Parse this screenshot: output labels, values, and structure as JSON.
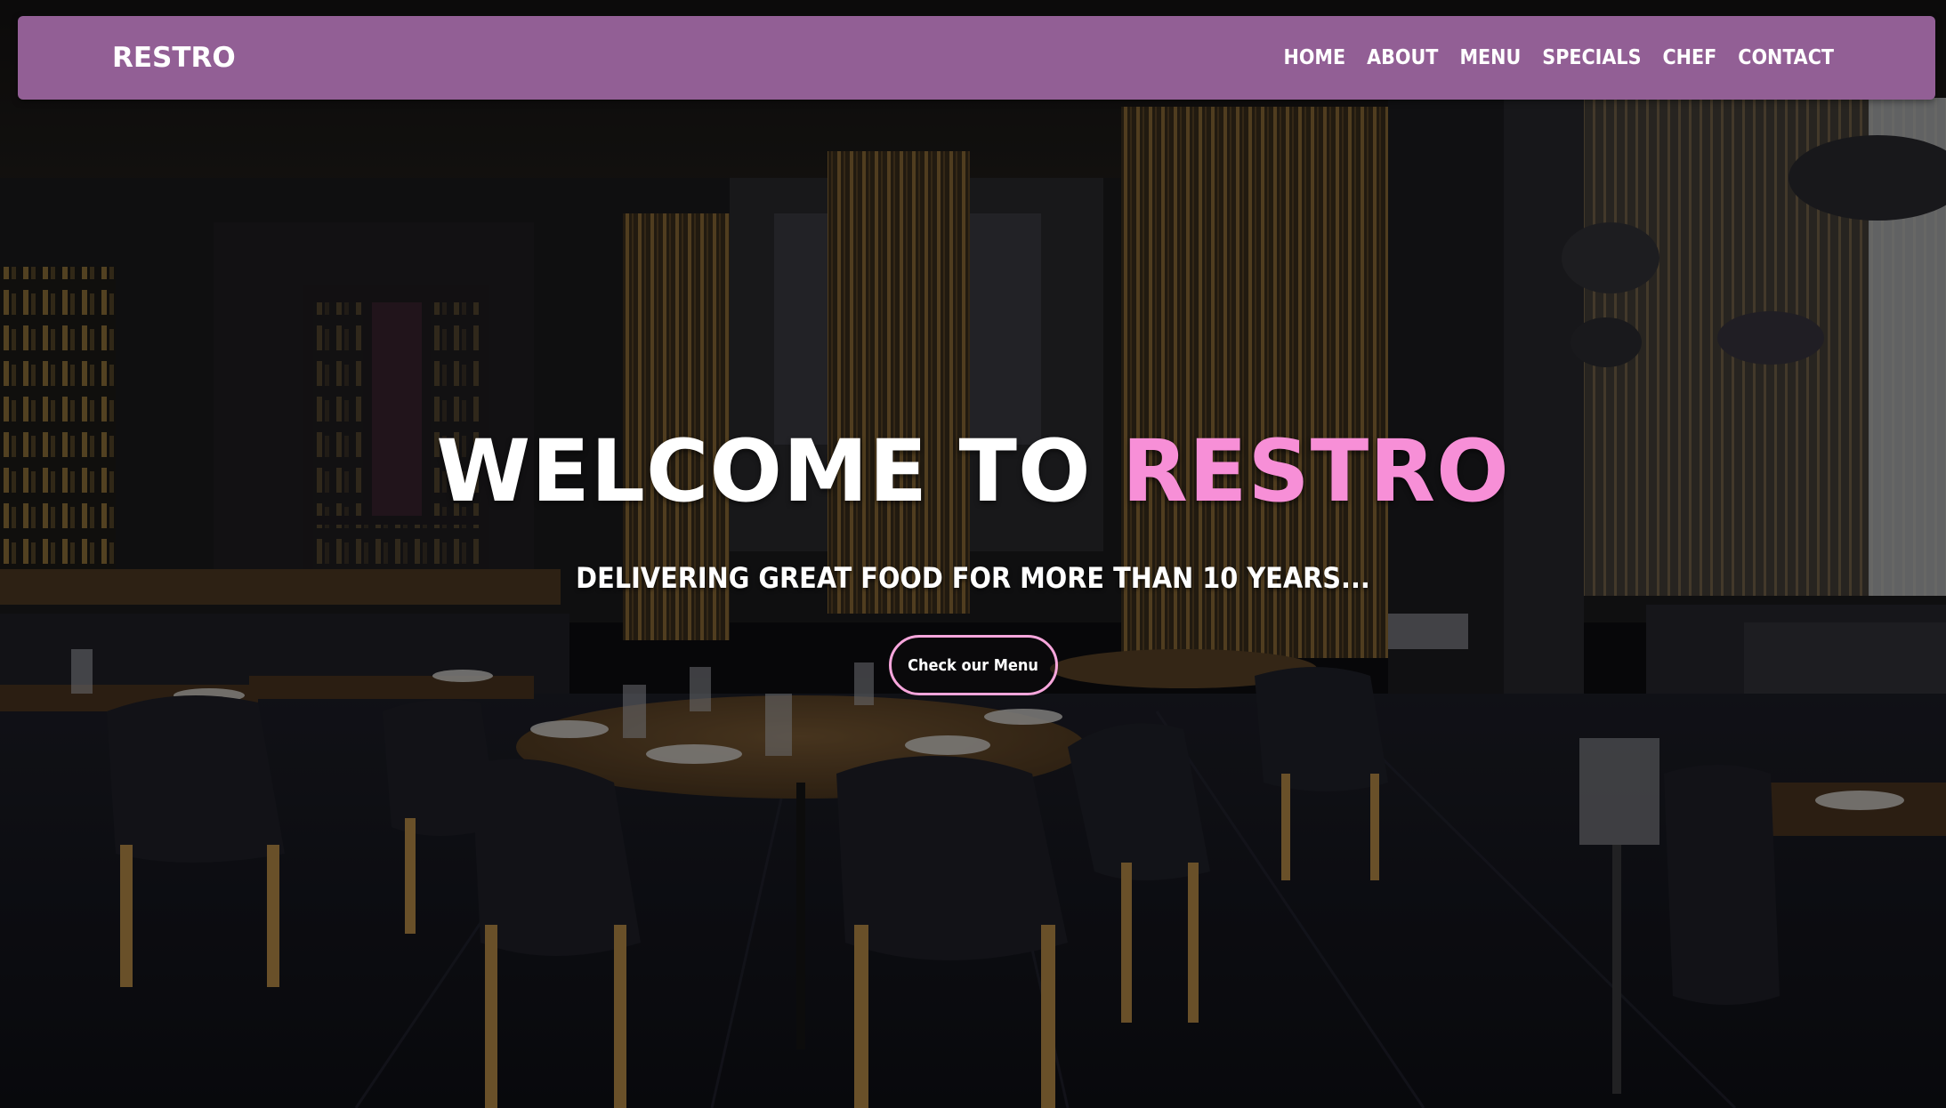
{
  "navbar": {
    "brand": "RESTRO",
    "links": [
      "HOME",
      "ABOUT",
      "MENU",
      "SPECIALS",
      "CHEF",
      "CONTACT"
    ]
  },
  "hero": {
    "title_lead": "WELCOME TO ",
    "title_accent": "RESTRO",
    "subtitle": "DELIVERING GREAT FOOD FOR MORE THAN 10 YEARS...",
    "cta_label": "Check our Menu"
  },
  "colors": {
    "navbar_bg": "#925f95",
    "accent_pink": "#f78fd7",
    "cta_border": "#f7a6dc",
    "text": "#ffffff"
  }
}
